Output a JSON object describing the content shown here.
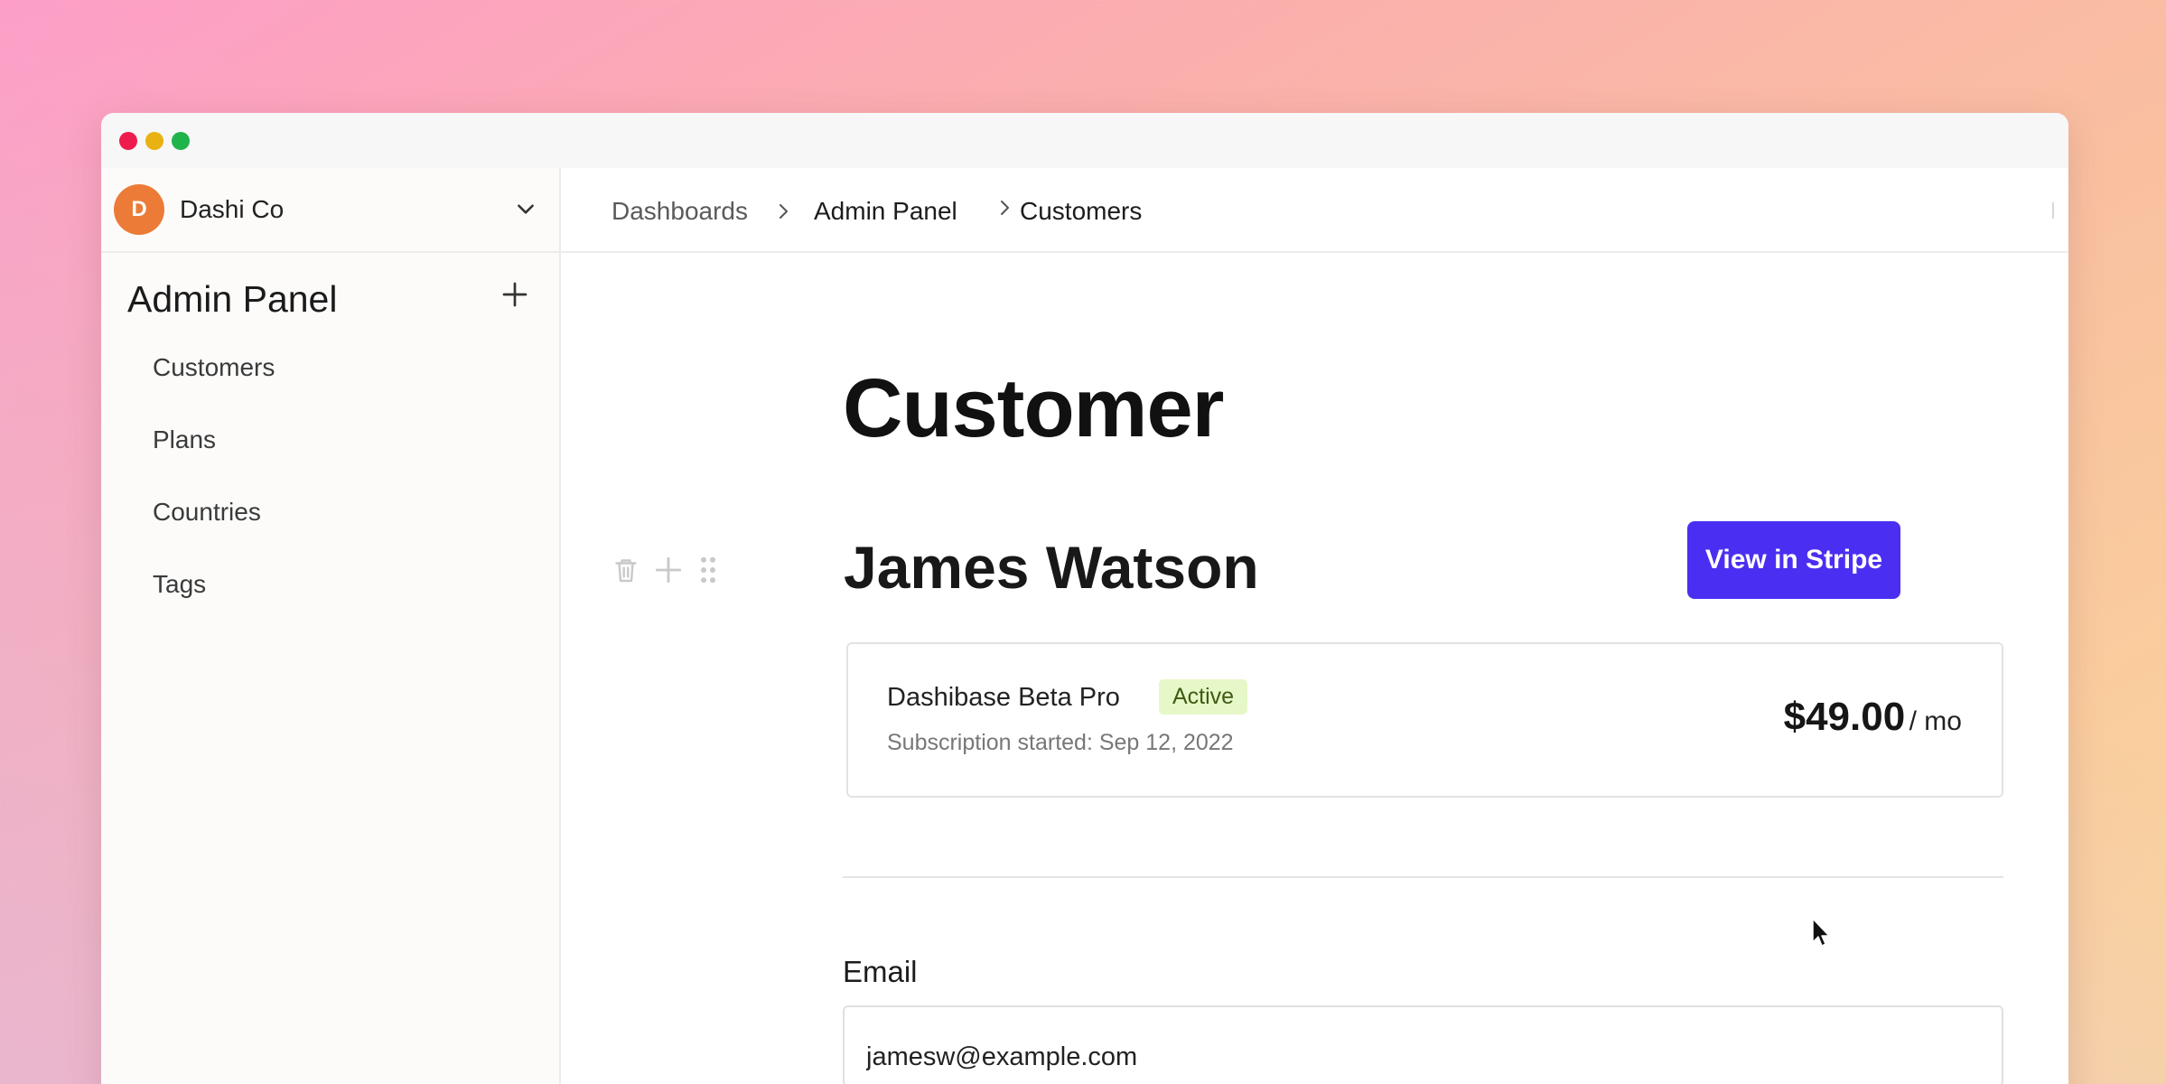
{
  "workspace": {
    "initial": "D",
    "name": "Dashi Co"
  },
  "sidebar": {
    "title": "Admin Panel",
    "items": [
      {
        "label": "Customers"
      },
      {
        "label": "Plans"
      },
      {
        "label": "Countries"
      },
      {
        "label": "Tags"
      }
    ]
  },
  "breadcrumb": [
    {
      "label": "Dashboards"
    },
    {
      "label": "Admin Panel"
    },
    {
      "label": "Customers"
    }
  ],
  "page": {
    "title": "Customer",
    "customer_name": "James Watson",
    "stripe_button": "View in Stripe"
  },
  "subscription": {
    "plan": "Dashibase Beta Pro",
    "status": "Active",
    "started": "Subscription started: Sep 12, 2022",
    "price": "$49.00",
    "period": "/ mo"
  },
  "email": {
    "label": "Email",
    "value": "jamesw@example.com"
  },
  "colors": {
    "accent": "#4a2ff2",
    "avatar": "#ec7b37",
    "status_badge_bg": "#e7f8c8"
  }
}
